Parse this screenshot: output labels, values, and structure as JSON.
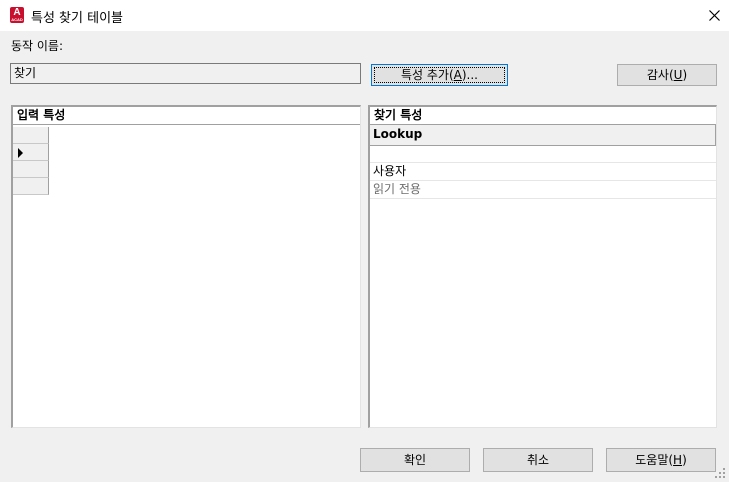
{
  "window": {
    "title": "특성 찾기 테이블",
    "app_icon_letter": "A",
    "app_icon_sub": "ACAD"
  },
  "form": {
    "action_name_label": "동작 이름:",
    "action_name_value": "찾기"
  },
  "buttons": {
    "add_properties": {
      "text": "특성 추가(",
      "accel": "A",
      "suffix": ")..."
    },
    "audit": {
      "text": "감사(",
      "accel": "U",
      "suffix": ")"
    },
    "ok": "확인",
    "cancel": "취소",
    "help": {
      "text": "도움말(",
      "accel": "H",
      "suffix": ")"
    }
  },
  "input_properties": {
    "header": "입력 특성",
    "rows": [
      "",
      "",
      "",
      ""
    ],
    "current_row_index": 1
  },
  "lookup_properties": {
    "header": "찾기 특성",
    "column_header": "Lookup",
    "rows": [
      {
        "value": "",
        "style": "normal"
      },
      {
        "value": "사용자",
        "style": "normal"
      },
      {
        "value": "읽기 전용",
        "style": "readonly"
      }
    ]
  },
  "icons": {
    "close": "close-icon",
    "current_row": "triangle-right-icon",
    "app": "autocad-app-icon",
    "resize": "resize-grip-icon"
  },
  "colors": {
    "app_icon": "#c8102e",
    "focus_border": "#0078d7",
    "readonly_text": "#6d6d6d"
  }
}
